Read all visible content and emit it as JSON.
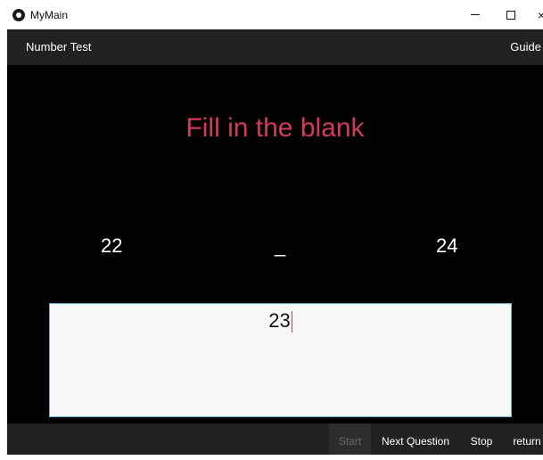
{
  "window": {
    "title": "MyMain",
    "minimize_label": "",
    "maximize_label": "",
    "close_label": "×"
  },
  "header": {
    "title": "Number Test",
    "guide_label": "Guide"
  },
  "main": {
    "prompt": "Fill in the blank",
    "sequence": {
      "left": "22",
      "blank": "_",
      "right": "24"
    },
    "answer": {
      "value": "23"
    }
  },
  "bottom_bar": {
    "start_label": "Start",
    "next_question_label": "Next Question",
    "stop_label": "Stop",
    "return_label": "return"
  },
  "colors": {
    "prompt": "#d43a5a",
    "header_bg": "#212121",
    "main_bg": "#000000",
    "answer_border": "#6ab0d2"
  }
}
